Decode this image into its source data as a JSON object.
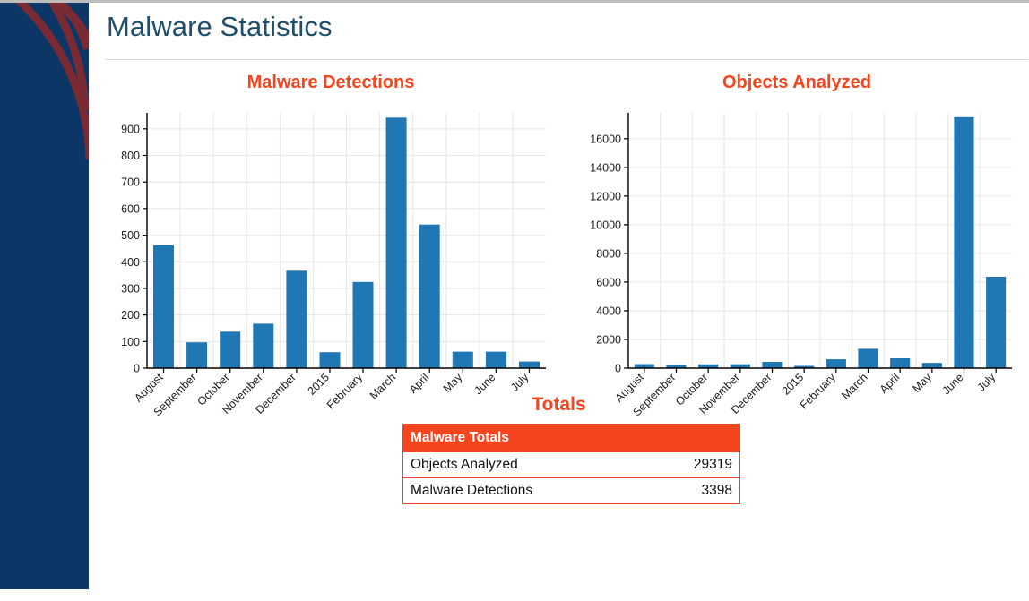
{
  "page": {
    "title": "Malware Statistics"
  },
  "colors": {
    "sidebar_navy": "#0b3665",
    "sidebar_arc": "#7a2a33",
    "title_blue": "#1f4e6b",
    "accent_orange": "#f4451e",
    "bar_blue": "#1f77b4",
    "grid_gray": "#e6e6e6",
    "axis_black": "#000000",
    "bottom_bar_gray": "#808080"
  },
  "totals": {
    "heading": "Totals",
    "table_header": "Malware Totals",
    "rows": [
      {
        "label": "Objects Analyzed",
        "value": "29319"
      },
      {
        "label": "Malware Detections",
        "value": "3398"
      }
    ]
  },
  "chart_data": [
    {
      "type": "bar",
      "id": "malware-detections",
      "title": "Malware Detections",
      "xlabel": "",
      "ylabel": "",
      "grid": true,
      "legend": "none",
      "ylim": [
        0,
        960
      ],
      "yticks": [
        0,
        100,
        200,
        300,
        400,
        500,
        600,
        700,
        800,
        900
      ],
      "categories": [
        "August",
        "September",
        "October",
        "November",
        "December",
        "2015",
        "February",
        "March",
        "April",
        "May",
        "June",
        "July"
      ],
      "values": [
        462,
        97,
        137,
        167,
        366,
        60,
        324,
        942,
        540,
        62,
        62,
        25
      ]
    },
    {
      "type": "bar",
      "id": "objects-analyzed",
      "title": "Objects Analyzed",
      "xlabel": "",
      "ylabel": "",
      "grid": true,
      "legend": "none",
      "ylim": [
        0,
        17800
      ],
      "yticks": [
        0,
        2000,
        4000,
        6000,
        8000,
        10000,
        12000,
        14000,
        16000
      ],
      "categories": [
        "August",
        "September",
        "October",
        "November",
        "December",
        "2015",
        "February",
        "March",
        "April",
        "May",
        "June",
        "July"
      ],
      "values": [
        280,
        200,
        260,
        270,
        440,
        155,
        620,
        1350,
        690,
        370,
        17500,
        6370
      ]
    }
  ]
}
